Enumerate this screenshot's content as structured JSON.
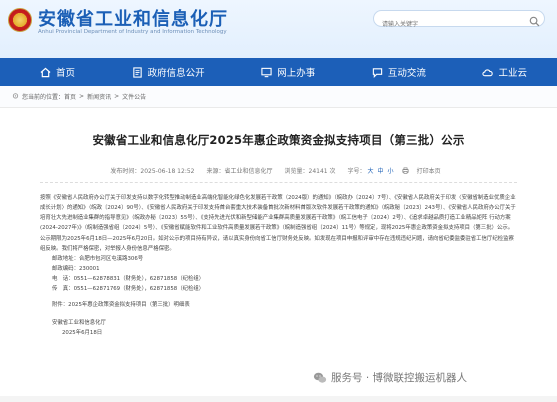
{
  "header": {
    "site_title": "安徽省工业和信息化厅",
    "site_subtitle": "Anhui Provincial Department of Industry and Information Technology",
    "search_placeholder": "请输入关键字"
  },
  "nav": {
    "items": [
      {
        "label": "首页",
        "icon": "home-icon"
      },
      {
        "label": "政府信息公开",
        "icon": "document-icon"
      },
      {
        "label": "网上办事",
        "icon": "monitor-icon"
      },
      {
        "label": "互动交流",
        "icon": "chat-icon"
      },
      {
        "label": "工业云",
        "icon": "cloud-icon"
      }
    ]
  },
  "breadcrumb": {
    "prefix": "您当前的位置：",
    "items": [
      "首页",
      "新闻资讯",
      "文件公告"
    ],
    "separator": ">"
  },
  "article": {
    "title": "安徽省工业和信息化厅2025年惠企政策资金拟支持项目（第三批）公示",
    "meta": {
      "date": "发布时间：2025-06-18 12:52",
      "source": "来源：省工业和信息化厅",
      "views": "浏览量：24141 次",
      "fontsize_label": "字号：",
      "font_large": "大",
      "font_medium": "中",
      "font_small": "小",
      "print": "打印本页"
    },
    "para1": "按照《安徽省人民政府办公厅关于印发支持以数字化转型推动制造业高端化智能化绿色化发展若干政策（2024版）的通知》（皖政办〔2024〕7号）、《安徽省人民政府关于印发〈安徽省制造业优质企业成长计划〉的通知》（皖政〔2024〕90号）、《安徽省人民政府关于印发支持首台套重大技术装备首批次新材料首版次软件发展若干政策的通知》（皖政秘〔2023〕243号）、《安徽省人民政府办公厅关于培育壮大先进制造业集群的指导意见》（皖政办秘〔2023〕55号）、《支持先进光伏和新型储能产业集群高质量发展若干政策》（皖工信电子〔2024〕2号）、《追求卓越品质打造工业精品矩阵 行动方案(2024-2027年)》（皖制造强省组〔2024〕5号）、《安徽省赋能软件和工业软件高质量发展若干政策》（皖制造强省组〔2024〕11号）等规定，现将2025年惠企政策资金拟支持项目（第三批）公示。",
    "para2": "公示期限为2025年6月18日—2025年6月20日。如对公示的项目持有异议，请以真实身份向省工信厅财务处反映。如发现在项目申报和评审中存在违规违纪问题，请向省纪委监委驻省工信厅纪检监察组反映。我们将严格保密，对举报人身份信息严格保密。",
    "contacts": [
      "邮政地址：合肥市包河区屯溪路306号",
      "邮政编码：230001",
      "电　话：0551—62878831（财务处），62871858（纪检组）",
      "传　真：0551—62871769（财务处），62871858（纪检组）"
    ],
    "attachment": "附件：2025年惠企政策资金拟支持项目（第三批）明细表",
    "signature": "安徽省工业和信息化厅",
    "sign_date": "2025年6月18日"
  },
  "watermark": {
    "text": "服务号 · 博微联控搬运机器人"
  },
  "colors": {
    "brand_blue": "#1c5fb8",
    "title_blue": "#1b5fb6"
  }
}
